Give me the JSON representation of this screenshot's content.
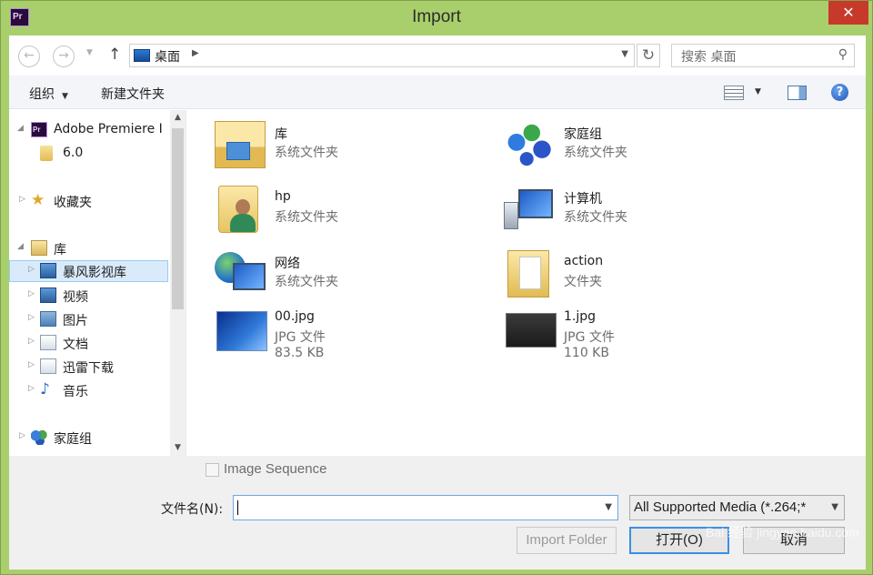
{
  "window": {
    "title": "Import",
    "app_icon": "Pr",
    "close_glyph": "✕"
  },
  "nav": {
    "back_glyph": "←",
    "forward_glyph": "→",
    "up_glyph": "↑",
    "address": "桌面",
    "refresh_glyph": "↻",
    "search_placeholder": "搜索 桌面"
  },
  "toolbar": {
    "organize": "组织",
    "new_folder": "新建文件夹",
    "help": "?"
  },
  "tree": {
    "items": [
      {
        "label": "Adobe Premiere I",
        "icon": "premiere-icon"
      },
      {
        "label": "6.0",
        "icon": "folder-icon"
      },
      {
        "label": "收藏夹",
        "icon": "star-icon"
      },
      {
        "label": "库",
        "icon": "library-icon"
      },
      {
        "label": "暴风影视库",
        "icon": "video-library-icon"
      },
      {
        "label": "视频",
        "icon": "video-icon"
      },
      {
        "label": "图片",
        "icon": "pictures-icon"
      },
      {
        "label": "文档",
        "icon": "documents-icon"
      },
      {
        "label": "迅雷下载",
        "icon": "download-icon"
      },
      {
        "label": "音乐",
        "icon": "music-icon"
      },
      {
        "label": "家庭组",
        "icon": "homegroup-icon"
      }
    ]
  },
  "files": [
    {
      "name": "库",
      "type": "系统文件夹",
      "size": ""
    },
    {
      "name": "家庭组",
      "type": "系统文件夹",
      "size": ""
    },
    {
      "name": "hp",
      "type": "系统文件夹",
      "size": ""
    },
    {
      "name": "计算机",
      "type": "系统文件夹",
      "size": ""
    },
    {
      "name": "网络",
      "type": "系统文件夹",
      "size": ""
    },
    {
      "name": "action",
      "type": "文件夹",
      "size": ""
    },
    {
      "name": "00.jpg",
      "type": "JPG 文件",
      "size": "83.5 KB"
    },
    {
      "name": "1.jpg",
      "type": "JPG 文件",
      "size": "110 KB"
    }
  ],
  "bottom": {
    "image_sequence": "Image Sequence",
    "filename_label": "文件名(N):",
    "filename_value": "",
    "filter": "All Supported Media (*.264;*",
    "import_folder": "Import Folder",
    "open": "打开(O)",
    "cancel": "取消"
  },
  "watermark": "Bai 经验 jingyan.baidu.com"
}
